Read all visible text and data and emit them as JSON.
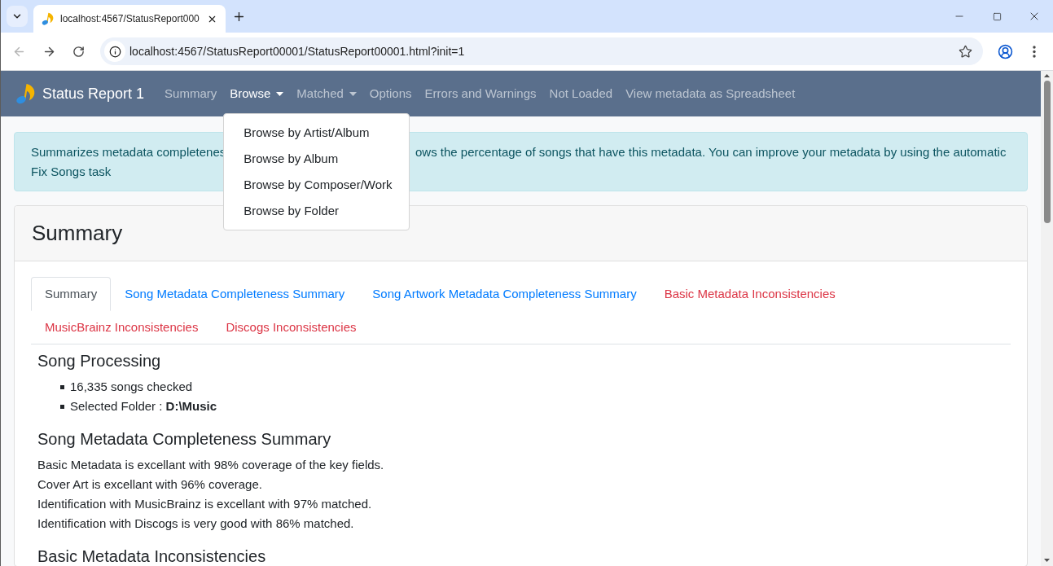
{
  "browser": {
    "tab_title": "localhost:4567/StatusReport000",
    "back_button": {
      "disabled": true
    },
    "forward_button": {
      "disabled": false
    },
    "url": "localhost:4567/StatusReport00001/StatusReport00001.html?init=1"
  },
  "navbar": {
    "brand": "Status Report 1",
    "items": [
      {
        "label": "Summary",
        "kind": "link",
        "selected": false
      },
      {
        "label": "Browse",
        "kind": "dropdown",
        "selected": true,
        "expanded": true,
        "menu": [
          "Browse by Artist/Album",
          "Browse by Album",
          "Browse by Composer/Work",
          "Browse by Folder"
        ]
      },
      {
        "label": "Matched",
        "kind": "dropdown",
        "selected": false
      },
      {
        "label": "Options",
        "kind": "link",
        "selected": false
      },
      {
        "label": "Errors and Warnings",
        "kind": "link",
        "selected": false
      },
      {
        "label": "Not Loaded",
        "kind": "link",
        "selected": false
      },
      {
        "label": "View metadata as Spreadsheet",
        "kind": "link",
        "selected": false
      }
    ]
  },
  "alert": {
    "text_before_menu": "Summarizes metadata completenes",
    "text_after_menu": "ows the percentage of songs that have this metadata. You can improve your metadata by using the automatic",
    "text_line_2": "Fix Songs task"
  },
  "card": {
    "title": "Summary",
    "tabs": [
      {
        "label": "Summary",
        "selected": true,
        "color": "#495057"
      },
      {
        "label": "Song Metadata Completeness Summary",
        "selected": false,
        "color": "#007bff"
      },
      {
        "label": "Song Artwork Metadata Completeness Summary",
        "selected": false,
        "color": "#007bff"
      },
      {
        "label": "Basic Metadata Inconsistencies",
        "selected": false,
        "color": "#dc3545"
      },
      {
        "label": "MusicBrainz Inconsistencies",
        "selected": false,
        "color": "#dc3545"
      },
      {
        "label": "Discogs Inconsistencies",
        "selected": false,
        "color": "#dc3545"
      }
    ],
    "content": [
      {
        "kind": "heading",
        "text": "Song Processing"
      },
      {
        "kind": "list",
        "items": [
          "16,335 songs checked",
          "Selected Folder : **D:\\Music**"
        ]
      },
      {
        "kind": "heading",
        "text": "Song Metadata Completeness Summary"
      },
      {
        "kind": "lines",
        "lines": [
          "Basic Metadata is excellant with 98% coverage of the key fields.",
          "Cover Art is excellant with 96% coverage.",
          "Identification with MusicBrainz is excellant with 97% matched.",
          "Identification with Discogs is very good with 86% matched."
        ]
      },
      {
        "kind": "heading",
        "text": "Basic Metadata Inconsistencies"
      }
    ]
  }
}
